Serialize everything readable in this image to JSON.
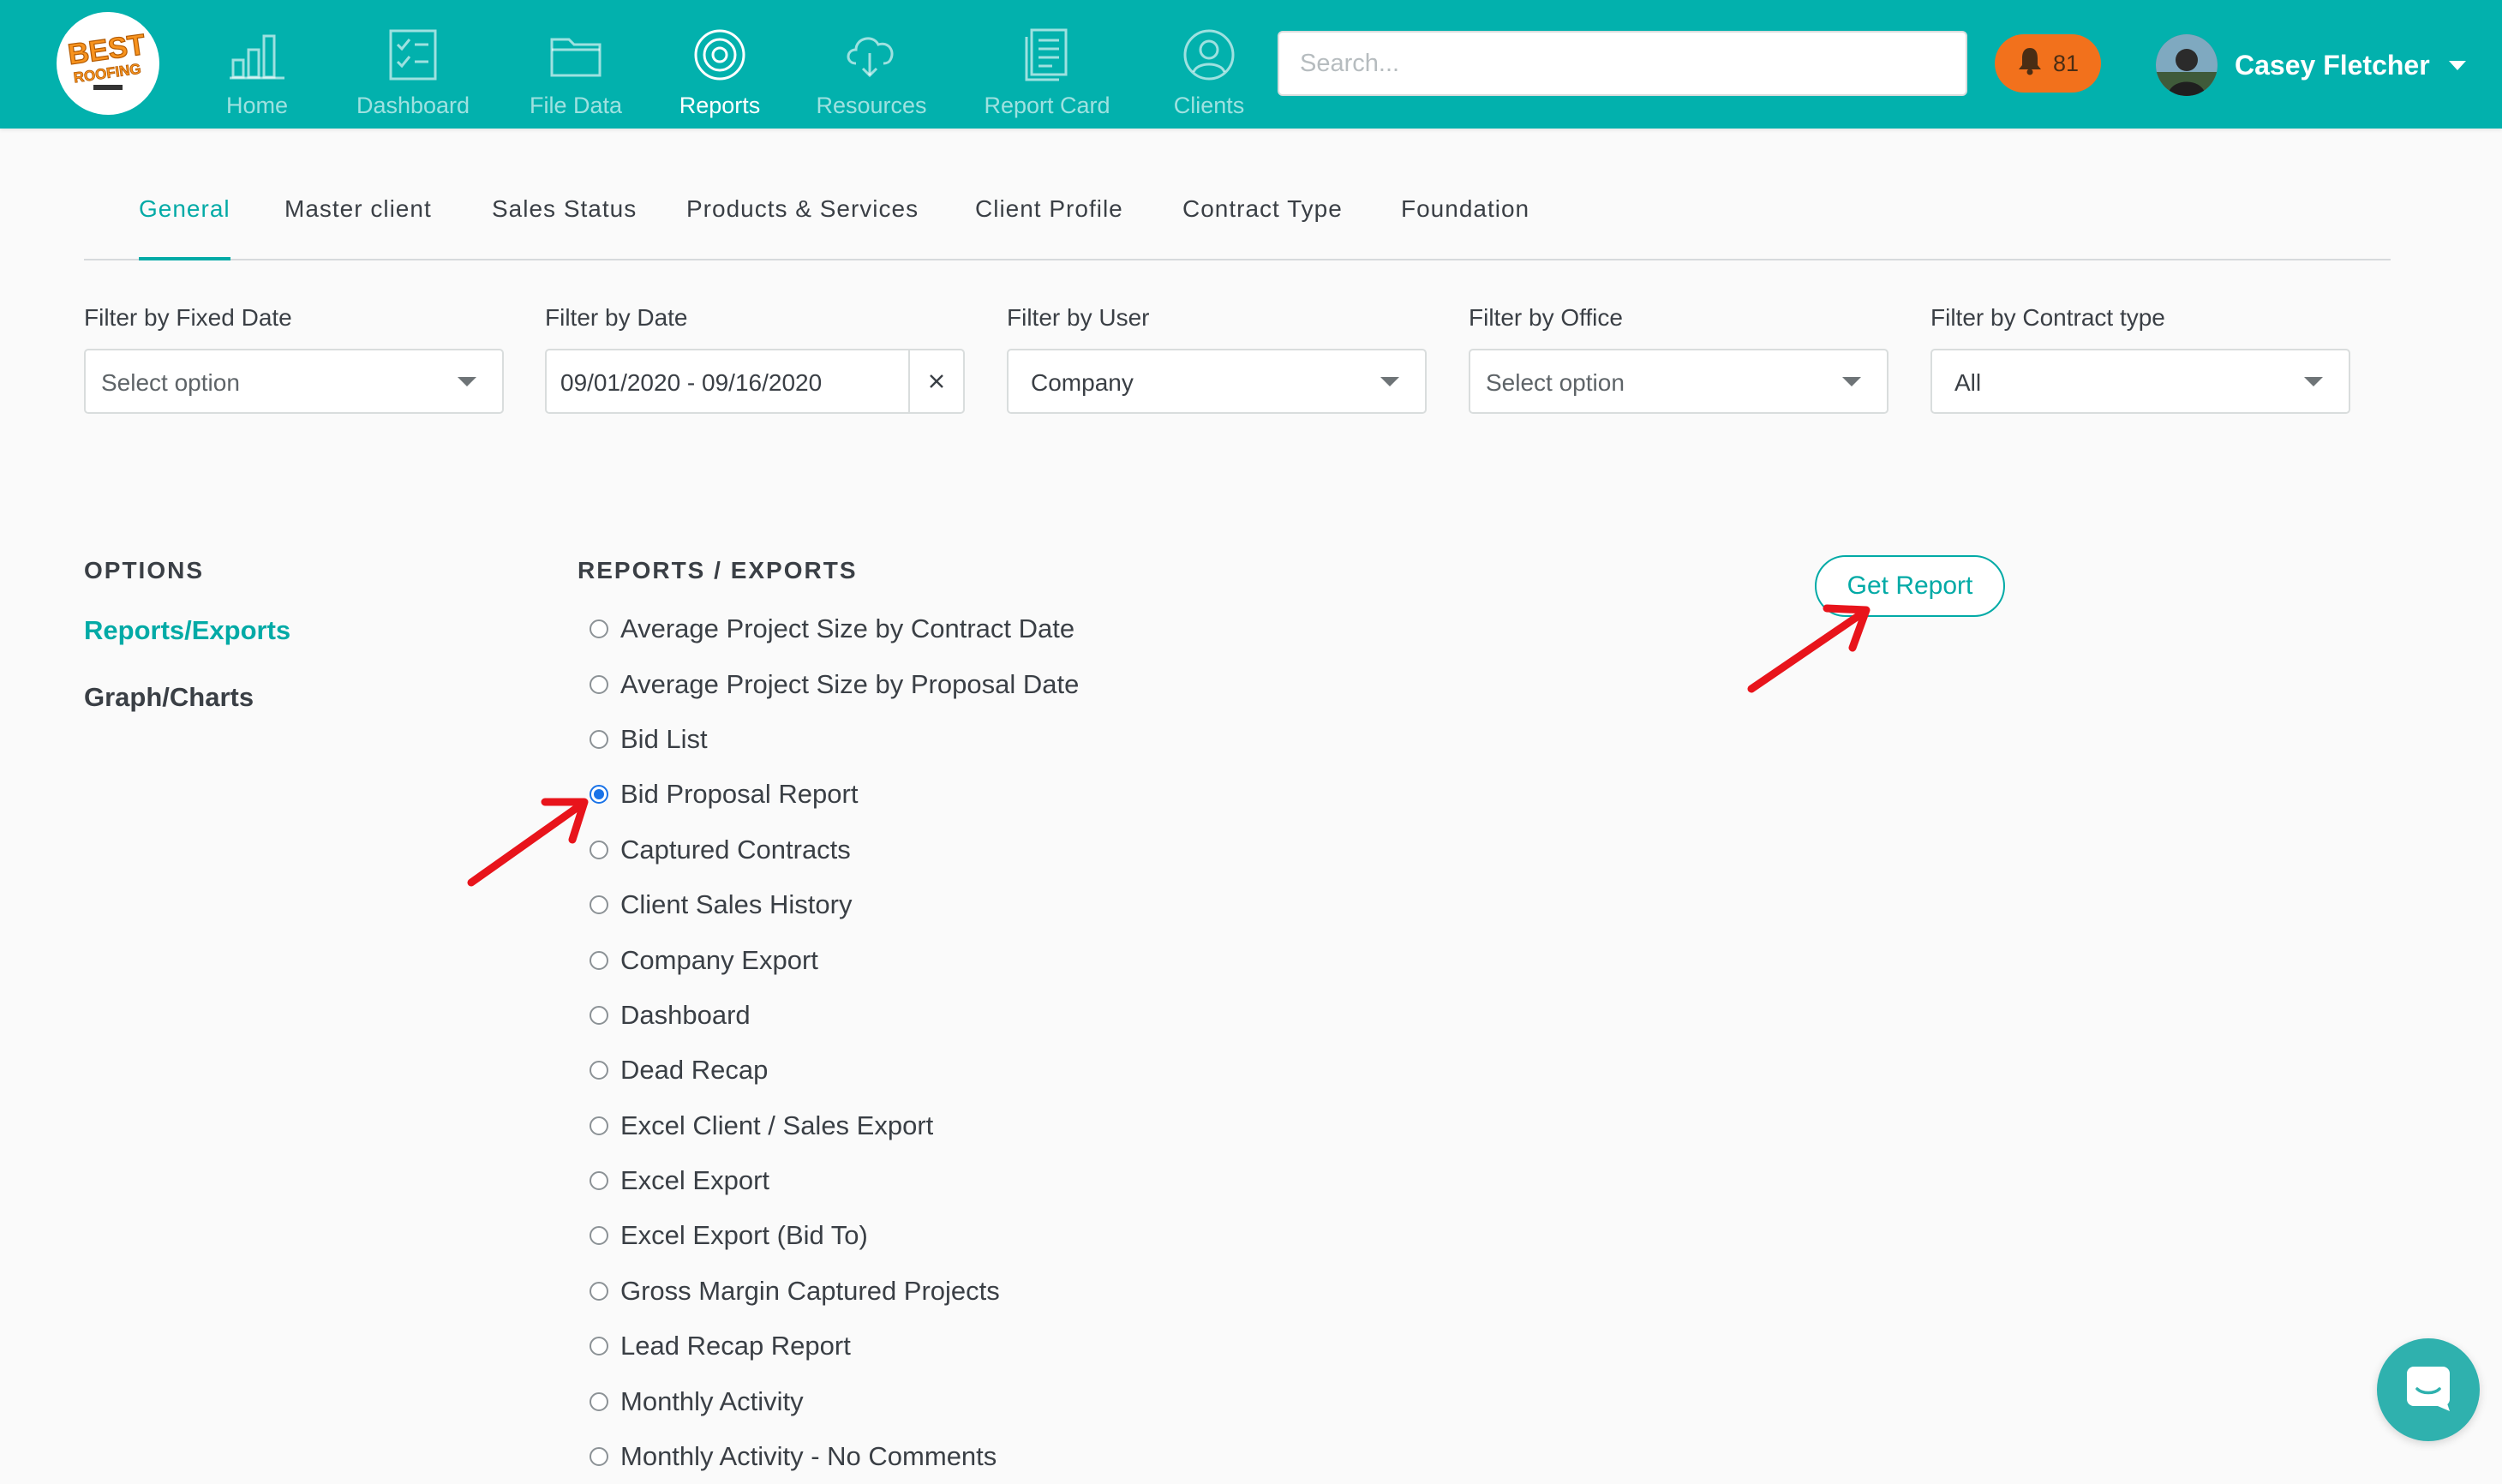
{
  "brand": {
    "logo_text_line1": "BEST",
    "logo_text_line2": "ROOFING",
    "accent_color": "#02b1ad"
  },
  "nav": {
    "items": [
      {
        "label": "Home",
        "icon": "bar-chart-icon",
        "active": false
      },
      {
        "label": "Dashboard",
        "icon": "checklist-icon",
        "active": false
      },
      {
        "label": "File Data",
        "icon": "folder-icon",
        "active": false
      },
      {
        "label": "Reports",
        "icon": "target-icon",
        "active": true
      },
      {
        "label": "Resources",
        "icon": "cloud-download-icon",
        "active": false
      },
      {
        "label": "Report Card",
        "icon": "document-icon",
        "active": false
      },
      {
        "label": "Clients",
        "icon": "user-circle-icon",
        "active": false
      }
    ]
  },
  "search": {
    "placeholder": "Search...",
    "value": ""
  },
  "notifications": {
    "count": "81",
    "icon": "bell-icon",
    "color": "#f2711c"
  },
  "user": {
    "name": "Casey Fletcher"
  },
  "tabs": [
    {
      "label": "General",
      "active": true
    },
    {
      "label": "Master client",
      "active": false
    },
    {
      "label": "Sales Status",
      "active": false
    },
    {
      "label": "Products & Services",
      "active": false
    },
    {
      "label": "Client Profile",
      "active": false
    },
    {
      "label": "Contract Type",
      "active": false
    },
    {
      "label": "Foundation",
      "active": false
    }
  ],
  "filters": {
    "fixed_date": {
      "label": "Filter by Fixed Date",
      "value": "Select option"
    },
    "date": {
      "label": "Filter by Date",
      "value": "09/01/2020 - 09/16/2020"
    },
    "user": {
      "label": "Filter by User",
      "value": "Company"
    },
    "office": {
      "label": "Filter by Office",
      "value": "Select option"
    },
    "contract_type": {
      "label": "Filter by Contract type",
      "value": "All"
    }
  },
  "options": {
    "heading": "OPTIONS",
    "items": [
      {
        "label": "Reports/Exports",
        "active": true
      },
      {
        "label": "Graph/Charts",
        "active": false
      }
    ]
  },
  "reports": {
    "heading": "REPORTS / EXPORTS",
    "selected": "Bid Proposal Report",
    "items": [
      "Average Project Size by Contract Date",
      "Average Project Size by Proposal Date",
      "Bid List",
      "Bid Proposal Report",
      "Captured Contracts",
      "Client Sales History",
      "Company Export",
      "Dashboard",
      "Dead Recap",
      "Excel Client / Sales Export",
      "Excel Export",
      "Excel Export (Bid To)",
      "Gross Margin Captured Projects",
      "Lead Recap Report",
      "Monthly Activity",
      "Monthly Activity - No Comments"
    ]
  },
  "actions": {
    "get_report_label": "Get Report"
  },
  "annotations": {
    "arrow_color": "#e8141b"
  },
  "chat": {
    "icon": "chat-icon"
  }
}
